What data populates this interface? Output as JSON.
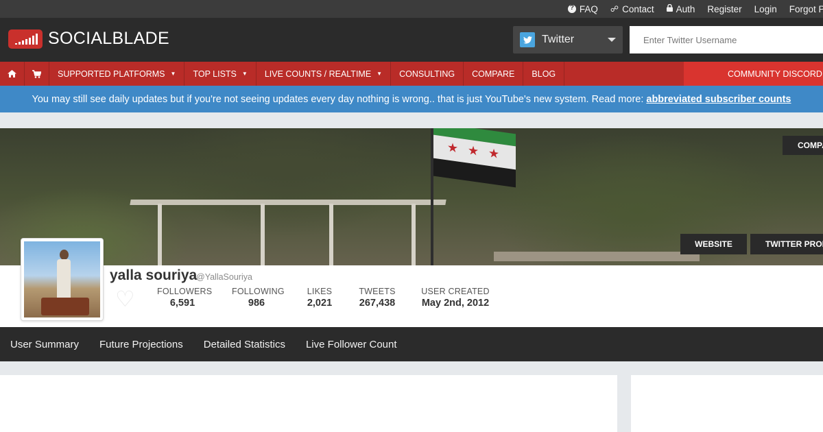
{
  "topbar": {
    "links": [
      {
        "label": "FAQ",
        "icon": "question-circle-icon"
      },
      {
        "label": "Contact",
        "icon": "ticket-icon"
      },
      {
        "label": "Auth",
        "icon": "lock-icon"
      },
      {
        "label": "Register"
      },
      {
        "label": "Login"
      },
      {
        "label": "Forgot Pa"
      }
    ]
  },
  "header": {
    "logo_text": "SOCIALBLADE",
    "platform_label": "Twitter",
    "search_placeholder": "Enter Twitter Username"
  },
  "nav": {
    "items": [
      {
        "label": "SUPPORTED PLATFORMS",
        "arrow": "▼"
      },
      {
        "label": "TOP LISTS",
        "arrow": "▼"
      },
      {
        "label": "LIVE COUNTS / REALTIME",
        "arrow": "▼"
      },
      {
        "label": "CONSULTING"
      },
      {
        "label": "COMPARE"
      },
      {
        "label": "BLOG"
      }
    ],
    "discord_label": "COMMUNITY DISCORD"
  },
  "notice": {
    "text": "You may still see daily updates but if you're not seeing updates every day nothing is wrong.. that is just YouTube's new system. Read more:",
    "link": "abbreviated subscriber counts"
  },
  "banner": {
    "compare_label": "COMPARE",
    "website_label": "WEBSITE",
    "profile_label": "TWITTER PROFILE"
  },
  "profile": {
    "name": "yalla souriya",
    "handle": "@YallaSouriya",
    "stats": [
      {
        "label": "FOLLOWERS",
        "value": "6,591"
      },
      {
        "label": "FOLLOWING",
        "value": "986"
      },
      {
        "label": "LIKES",
        "value": "2,021"
      },
      {
        "label": "TWEETS",
        "value": "267,438"
      },
      {
        "label": "USER CREATED",
        "value": "May 2nd, 2012"
      }
    ]
  },
  "tabs": [
    "User Summary",
    "Future Projections",
    "Detailed Statistics",
    "Live Follower Count"
  ],
  "colors": {
    "brand_red": "#b92c28",
    "discord_red": "#d9342f",
    "notice_blue": "#3f89c7",
    "header_dark": "#2b2b2b",
    "twitter_blue": "#4aa5df"
  }
}
